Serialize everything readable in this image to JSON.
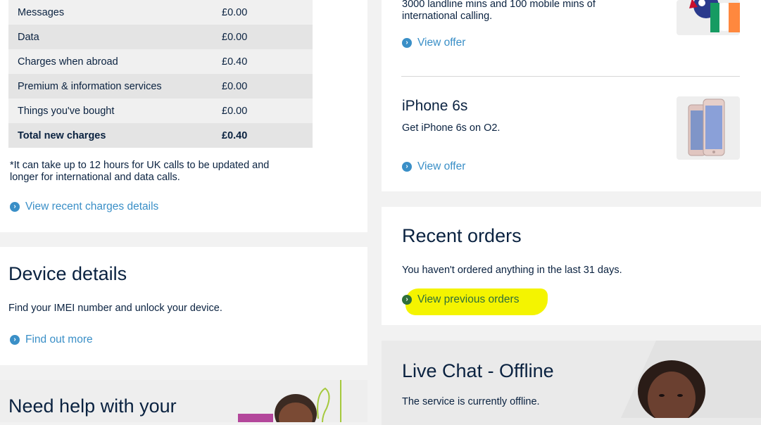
{
  "charges": {
    "rows": [
      {
        "label": "Messages",
        "amount": "£0.00"
      },
      {
        "label": "Data",
        "amount": "£0.00"
      },
      {
        "label": "Charges when abroad",
        "amount": "£0.40"
      },
      {
        "label": "Premium & information services",
        "amount": "£0.00"
      },
      {
        "label": "Things you've bought",
        "amount": "£0.00"
      }
    ],
    "total": {
      "label": "Total new charges",
      "amount": "£0.40"
    },
    "note": "*It can take up to 12 hours for UK calls to be updated and longer for international and data calls.",
    "link": "View recent charges details"
  },
  "device": {
    "title": "Device details",
    "desc": "Find your IMEI number and unlock your device.",
    "link": "Find out more"
  },
  "help": {
    "title": "Need help with your"
  },
  "offers": {
    "international": {
      "desc": "3000 landline mins and 100 mobile mins of international calling.",
      "link": "View offer"
    },
    "iphone": {
      "title": "iPhone 6s",
      "desc": "Get iPhone 6s on O2.",
      "link": "View offer"
    }
  },
  "orders": {
    "title": "Recent orders",
    "desc": "You haven't ordered anything in the last 31 days.",
    "link": "View previous orders"
  },
  "livechat": {
    "title": "Live Chat - Offline",
    "desc": "The service is currently offline."
  },
  "icons": {
    "link_chevron": "chevron-right-circle-icon"
  },
  "colors": {
    "navy_text": "#0a2240",
    "link_blue": "#3a8fc7",
    "highlight": "#f4f400"
  }
}
